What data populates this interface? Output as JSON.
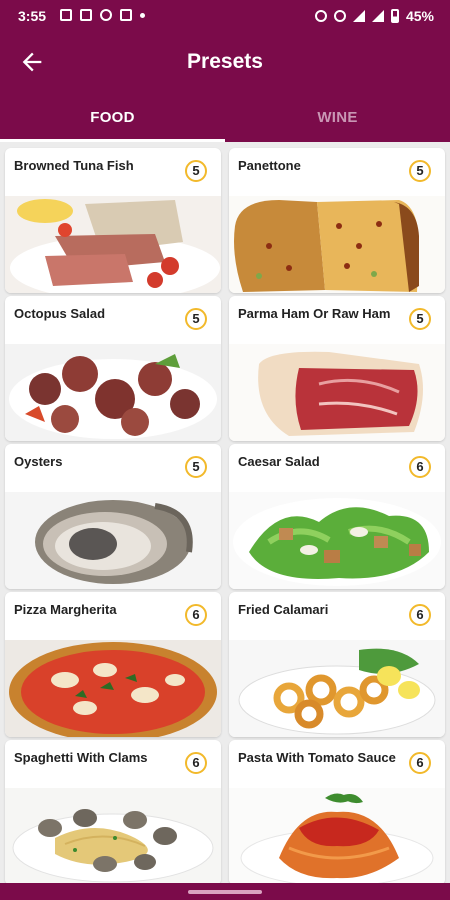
{
  "status": {
    "time": "3:55",
    "battery": "45%"
  },
  "appbar": {
    "title": "Presets"
  },
  "tabs": [
    {
      "label": "FOOD",
      "selected": true
    },
    {
      "label": "WINE",
      "selected": false
    }
  ],
  "colors": {
    "brand": "#7B0B4A",
    "badge_ring": "#F2B92B"
  },
  "items": [
    {
      "name": "Browned Tuna Fish",
      "count": "5"
    },
    {
      "name": "Panettone",
      "count": "5"
    },
    {
      "name": "Octopus Salad",
      "count": "5"
    },
    {
      "name": "Parma Ham Or Raw Ham",
      "count": "5"
    },
    {
      "name": "Oysters",
      "count": "5"
    },
    {
      "name": "Caesar Salad",
      "count": "6"
    },
    {
      "name": "Pizza Margherita",
      "count": "6"
    },
    {
      "name": "Fried Calamari",
      "count": "6"
    },
    {
      "name": "Spaghetti With Clams",
      "count": "6"
    },
    {
      "name": "Pasta With Tomato Sauce",
      "count": "6"
    }
  ]
}
